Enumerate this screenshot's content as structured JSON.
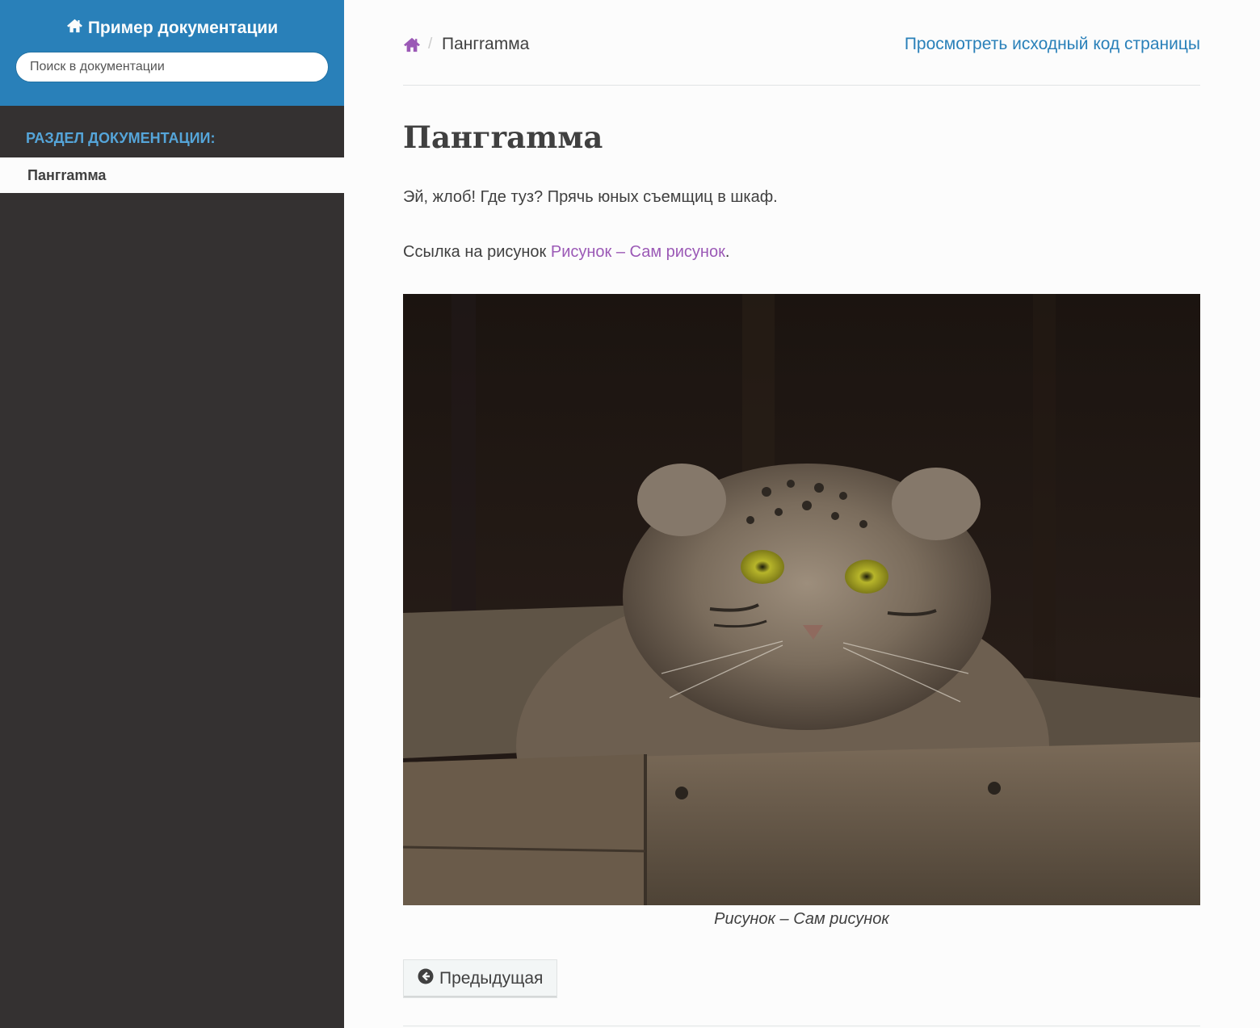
{
  "sidebar": {
    "brand_title": "Пример документации",
    "search_placeholder": "Поиск в документации",
    "caption": "Раздел документации:",
    "current_item": "Пангramма"
  },
  "breadcrumbs": {
    "separator": "/",
    "current": "Пангramма",
    "view_source": "Просмотреть исходный код страницы"
  },
  "page": {
    "title": "Пангramма",
    "pangram": "Эй, жлоб! Где туз? Прячь юных съемщиц в шкаф.",
    "ref_prefix": "Ссылка на рисунок ",
    "ref_link": "Рисунок – Сам рисунок",
    "ref_suffix": ".",
    "figure_caption": "Рисунок – Сам рисунок"
  },
  "nav": {
    "prev_label": "Предыдущая"
  },
  "colors": {
    "sidebar_head": "#2980b9",
    "sidebar_bg": "#343131",
    "caption": "#55a5d9",
    "link": "#2980b9",
    "visited_link": "#9b59b6"
  },
  "icons": {
    "brand": "home-icon",
    "breadcrumb_home": "home-icon",
    "prev": "arrow-circle-left-icon"
  }
}
